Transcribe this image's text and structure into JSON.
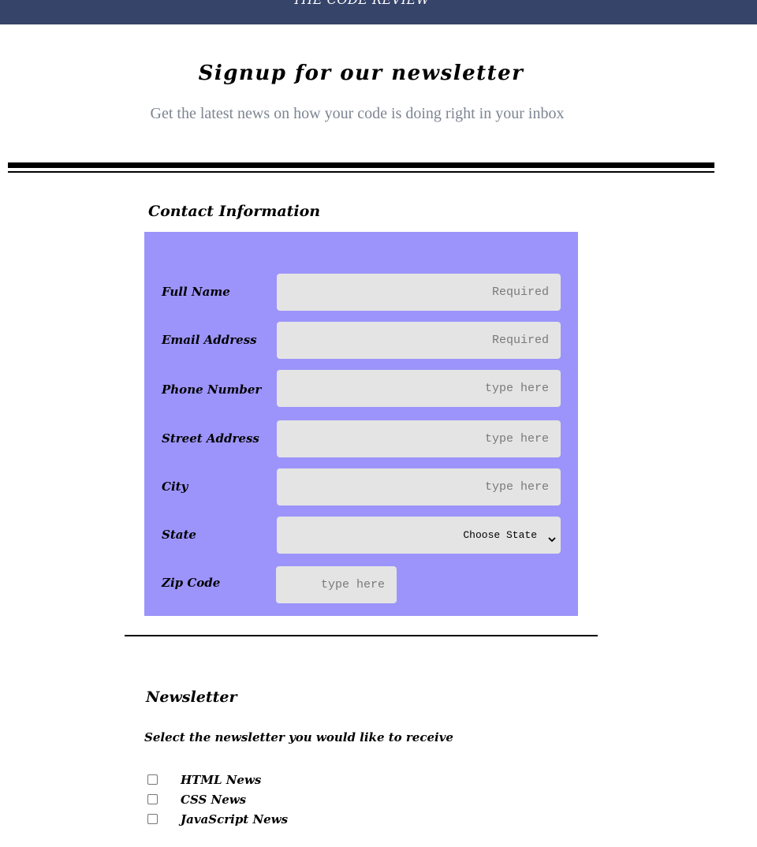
{
  "header": {
    "brand": "THE CODE REVIEW"
  },
  "hero": {
    "title": "Signup for our newsletter",
    "subtitle": "Get the latest news on how your code is doing right in your inbox"
  },
  "contact": {
    "section_title": "Contact Information",
    "fields": {
      "full_name": {
        "label": "Full Name",
        "placeholder": "Required"
      },
      "email": {
        "label": "Email Address",
        "placeholder": "Required"
      },
      "phone": {
        "label": "Phone Number",
        "placeholder": "type here"
      },
      "street": {
        "label": "Street Address",
        "placeholder": "type here"
      },
      "city": {
        "label": "City",
        "placeholder": "type here"
      },
      "state": {
        "label": "State",
        "selected": "Choose State"
      },
      "zip": {
        "label": "Zip Code",
        "placeholder": "type here"
      }
    }
  },
  "newsletter": {
    "section_title": "Newsletter",
    "intro": "Select the newsletter you would like to receive",
    "options": [
      {
        "label": "HTML News",
        "checked": false
      },
      {
        "label": "CSS News",
        "checked": false
      },
      {
        "label": "JavaScript News",
        "checked": false
      }
    ]
  },
  "colors": {
    "header_bg": "#37446a",
    "form_panel_bg": "#9c94fa",
    "field_bg": "#e4e4e4",
    "subtitle_text": "#7d8592"
  }
}
